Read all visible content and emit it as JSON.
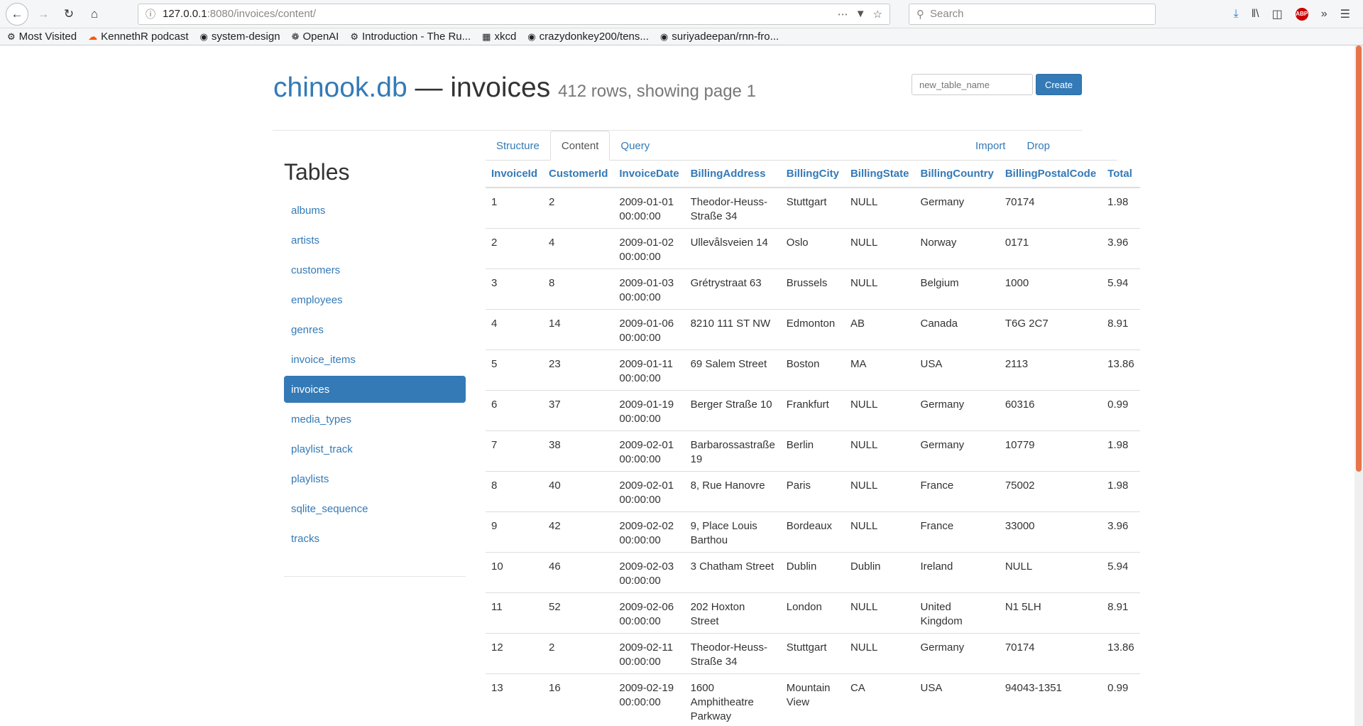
{
  "browser": {
    "url_host": "127.0.0.1",
    "url_path": ":8080/invoices/content/",
    "search_placeholder": "Search",
    "bookmarks": [
      {
        "label": "Most Visited",
        "icon": "gear-icon"
      },
      {
        "label": "KennethR podcast",
        "icon": "soundcloud-icon"
      },
      {
        "label": "system-design",
        "icon": "github-icon"
      },
      {
        "label": "OpenAI",
        "icon": "openai-icon"
      },
      {
        "label": "Introduction - The Ru...",
        "icon": "rust-icon"
      },
      {
        "label": "xkcd",
        "icon": "xkcd-icon"
      },
      {
        "label": "crazydonkey200/tens...",
        "icon": "github-icon"
      },
      {
        "label": "suriyadeepan/rnn-fro...",
        "icon": "github-icon"
      }
    ]
  },
  "header": {
    "db_name": "chinook.db",
    "separator": " — ",
    "table_name": "invoices",
    "row_info": "412 rows, showing page 1",
    "new_table_placeholder": "new_table_name",
    "create_label": "Create"
  },
  "sidebar": {
    "title": "Tables",
    "items": [
      "albums",
      "artists",
      "customers",
      "employees",
      "genres",
      "invoice_items",
      "invoices",
      "media_types",
      "playlist_track",
      "playlists",
      "sqlite_sequence",
      "tracks"
    ],
    "active": "invoices"
  },
  "tabs": {
    "structure": "Structure",
    "content": "Content",
    "query": "Query",
    "import": "Import",
    "drop": "Drop"
  },
  "table": {
    "columns": [
      "InvoiceId",
      "CustomerId",
      "InvoiceDate",
      "BillingAddress",
      "BillingCity",
      "BillingState",
      "BillingCountry",
      "BillingPostalCode",
      "Total"
    ],
    "rows": [
      [
        "1",
        "2",
        "2009-01-01 00:00:00",
        "Theodor-Heuss-Straße 34",
        "Stuttgart",
        "NULL",
        "Germany",
        "70174",
        "1.98"
      ],
      [
        "2",
        "4",
        "2009-01-02 00:00:00",
        "Ullevålsveien 14",
        "Oslo",
        "NULL",
        "Norway",
        "0171",
        "3.96"
      ],
      [
        "3",
        "8",
        "2009-01-03 00:00:00",
        "Grétrystraat 63",
        "Brussels",
        "NULL",
        "Belgium",
        "1000",
        "5.94"
      ],
      [
        "4",
        "14",
        "2009-01-06 00:00:00",
        "8210 111 ST NW",
        "Edmonton",
        "AB",
        "Canada",
        "T6G 2C7",
        "8.91"
      ],
      [
        "5",
        "23",
        "2009-01-11 00:00:00",
        "69 Salem Street",
        "Boston",
        "MA",
        "USA",
        "2113",
        "13.86"
      ],
      [
        "6",
        "37",
        "2009-01-19 00:00:00",
        "Berger Straße 10",
        "Frankfurt",
        "NULL",
        "Germany",
        "60316",
        "0.99"
      ],
      [
        "7",
        "38",
        "2009-02-01 00:00:00",
        "Barbarossastraße 19",
        "Berlin",
        "NULL",
        "Germany",
        "10779",
        "1.98"
      ],
      [
        "8",
        "40",
        "2009-02-01 00:00:00",
        "8, Rue Hanovre",
        "Paris",
        "NULL",
        "France",
        "75002",
        "1.98"
      ],
      [
        "9",
        "42",
        "2009-02-02 00:00:00",
        "9, Place Louis Barthou",
        "Bordeaux",
        "NULL",
        "France",
        "33000",
        "3.96"
      ],
      [
        "10",
        "46",
        "2009-02-03 00:00:00",
        "3 Chatham Street",
        "Dublin",
        "Dublin",
        "Ireland",
        "NULL",
        "5.94"
      ],
      [
        "11",
        "52",
        "2009-02-06 00:00:00",
        "202 Hoxton Street",
        "London",
        "NULL",
        "United Kingdom",
        "N1 5LH",
        "8.91"
      ],
      [
        "12",
        "2",
        "2009-02-11 00:00:00",
        "Theodor-Heuss-Straße 34",
        "Stuttgart",
        "NULL",
        "Germany",
        "70174",
        "13.86"
      ],
      [
        "13",
        "16",
        "2009-02-19 00:00:00",
        "1600 Amphitheatre Parkway",
        "Mountain View",
        "CA",
        "USA",
        "94043-1351",
        "0.99"
      ]
    ]
  }
}
